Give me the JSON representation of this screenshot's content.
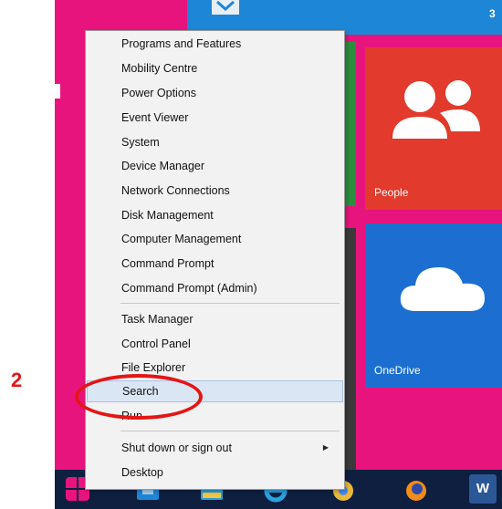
{
  "step_number": "2",
  "topbar": {
    "text": "3"
  },
  "tiles": [
    {
      "label": "People",
      "color": "#e23a2c",
      "icon": "people-icon"
    },
    {
      "label": "OneDrive",
      "color": "#1c6fd1",
      "icon": "cloud-icon"
    }
  ],
  "menu": {
    "items": [
      {
        "label": "Programs and Features"
      },
      {
        "label": "Mobility Centre"
      },
      {
        "label": "Power Options"
      },
      {
        "label": "Event Viewer"
      },
      {
        "label": "System"
      },
      {
        "label": "Device Manager"
      },
      {
        "label": "Network Connections"
      },
      {
        "label": "Disk Management"
      },
      {
        "label": "Computer Management"
      },
      {
        "label": "Command Prompt"
      },
      {
        "label": "Command Prompt (Admin)"
      },
      {
        "label": "Task Manager"
      },
      {
        "label": "Control Panel"
      },
      {
        "label": "File Explorer"
      },
      {
        "label": "Search",
        "highlighted": true
      },
      {
        "label": "Run"
      },
      {
        "label": "Shut down or sign out",
        "has_submenu": true
      },
      {
        "label": "Desktop"
      }
    ]
  },
  "taskbar": {
    "icons": [
      "start-icon",
      "store-icon",
      "photos-icon",
      "ie-icon",
      "chrome-icon",
      "firefox-icon",
      "word-icon"
    ],
    "word_letter": "W"
  },
  "colors": {
    "background": "#e8147e",
    "taskbar": "#0f1f40",
    "annotation": "#e51515",
    "menu_background": "#f2f2f2",
    "highlight": "#dbe6f5"
  }
}
